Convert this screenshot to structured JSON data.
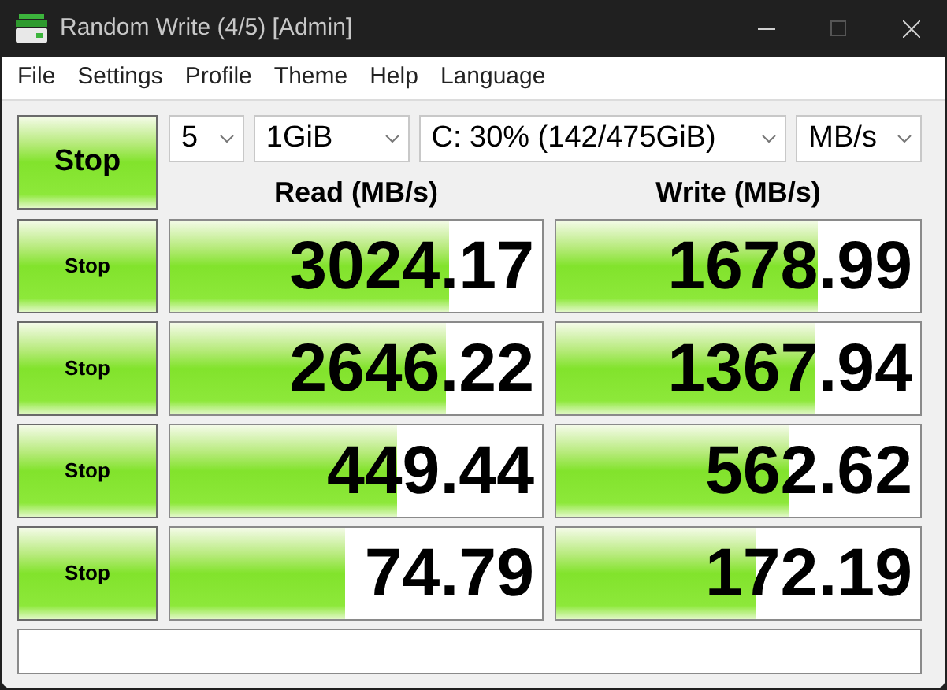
{
  "window": {
    "title": "Random Write (4/5) [Admin]"
  },
  "menu": [
    "File",
    "Settings",
    "Profile",
    "Theme",
    "Help",
    "Language"
  ],
  "main_button": {
    "label": "Stop"
  },
  "selectors": [
    {
      "value": "5"
    },
    {
      "value": "1GiB"
    },
    {
      "value": "C: 30% (142/475GiB)"
    },
    {
      "value": "MB/s"
    }
  ],
  "headers": {
    "read": "Read (MB/s)",
    "write": "Write (MB/s)"
  },
  "rows": [
    {
      "button": "Stop",
      "read": {
        "value": "3024.17",
        "level": 0.75
      },
      "write": {
        "value": "1678.99",
        "level": 0.72
      }
    },
    {
      "button": "Stop",
      "read": {
        "value": "2646.22",
        "level": 0.74
      },
      "write": {
        "value": "1367.94",
        "level": 0.71
      }
    },
    {
      "button": "Stop",
      "read": {
        "value": "449.44",
        "level": 0.61
      },
      "write": {
        "value": "562.62",
        "level": 0.64
      }
    },
    {
      "button": "Stop",
      "read": {
        "value": "74.79",
        "level": 0.47
      },
      "write": {
        "value": "172.19",
        "level": 0.55
      }
    }
  ]
}
